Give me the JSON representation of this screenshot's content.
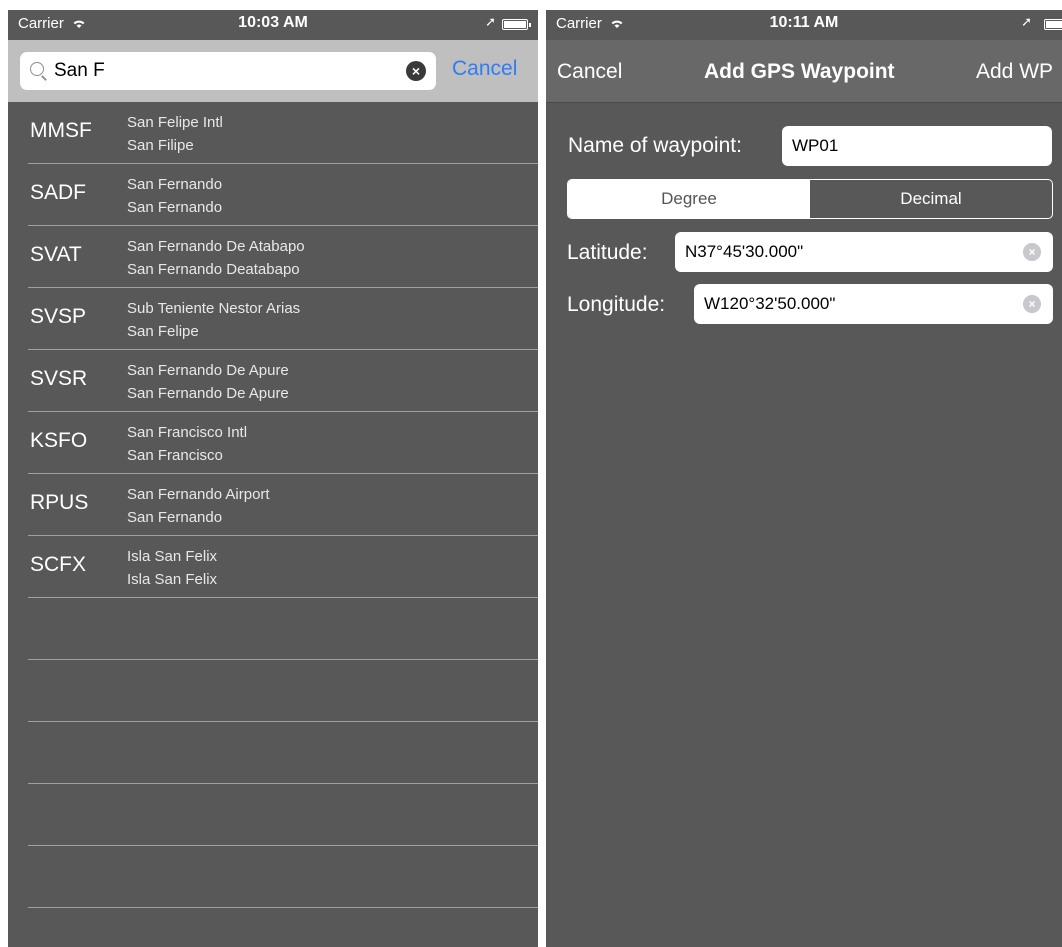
{
  "left": {
    "status": {
      "carrier": "Carrier",
      "time": "10:03 AM"
    },
    "search": {
      "query": "San F",
      "cancel": "Cancel"
    },
    "results": [
      {
        "code": "MMSF",
        "name": "San Felipe Intl",
        "city": "San Filipe"
      },
      {
        "code": "SADF",
        "name": "San Fernando",
        "city": "San Fernando"
      },
      {
        "code": "SVAT",
        "name": "San Fernando De Atabapo",
        "city": "San Fernando Deatabapo"
      },
      {
        "code": "SVSP",
        "name": "Sub Teniente Nestor Arias",
        "city": "San Felipe"
      },
      {
        "code": "SVSR",
        "name": "San Fernando De Apure",
        "city": "San Fernando De Apure"
      },
      {
        "code": "KSFO",
        "name": "San Francisco Intl",
        "city": "San Francisco"
      },
      {
        "code": "RPUS",
        "name": "San Fernando Airport",
        "city": "San Fernando"
      },
      {
        "code": "SCFX",
        "name": "Isla San Felix",
        "city": "Isla San Felix"
      }
    ]
  },
  "right": {
    "status": {
      "carrier": "Carrier",
      "time": "10:11 AM"
    },
    "nav": {
      "cancel": "Cancel",
      "title": "Add GPS Waypoint",
      "add": "Add WP"
    },
    "form": {
      "name_label": "Name of waypoint:",
      "name_value": "WP01",
      "segments": [
        "Degree",
        "Decimal"
      ],
      "selected_segment": "Degree",
      "latitude_label": "Latitude:",
      "latitude_value": "N37°45'30.000\"",
      "longitude_label": "Longitude:",
      "longitude_value": "W120°32'50.000\""
    }
  },
  "colors": {
    "background": "#585858",
    "accent": "#2f7cf6",
    "search_bar": "#bfbfbf",
    "nav_bar": "#686868"
  }
}
